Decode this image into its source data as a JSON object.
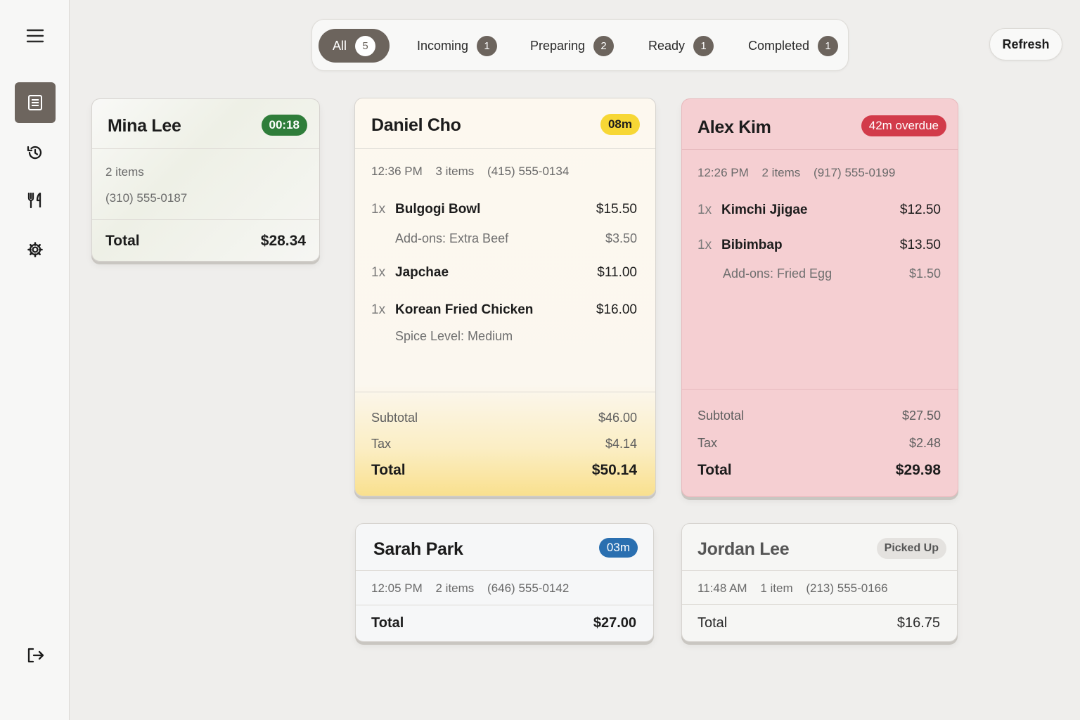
{
  "sidebar": {
    "items": [
      {
        "icon": "menu-icon"
      },
      {
        "icon": "orders-icon",
        "active": true
      },
      {
        "icon": "history-icon"
      },
      {
        "icon": "utensils-icon"
      },
      {
        "icon": "gear-icon"
      },
      {
        "icon": "logout-icon"
      }
    ]
  },
  "tabs": [
    {
      "label": "All",
      "count": "5",
      "active": true
    },
    {
      "label": "Incoming",
      "count": "1"
    },
    {
      "label": "Preparing",
      "count": "2"
    },
    {
      "label": "Ready",
      "count": "1"
    },
    {
      "label": "Completed",
      "count": "1"
    }
  ],
  "refresh_label": "Refresh",
  "colors": {
    "accent": "#6c645d",
    "badge_green": "#2f7d3a",
    "badge_yellow": "#f7d735",
    "badge_red": "#d23b4a",
    "badge_blue": "#2a6fb0",
    "badge_gray": "#e4e2df",
    "overdue_bg": "#f5cfd2",
    "preparing_bg": "#fbf3e2"
  },
  "orders": {
    "mina": {
      "customer": "Mina Lee",
      "badge": "00:18",
      "items_count": "2 items",
      "phone": "(310) 555-0187",
      "total_label": "Total",
      "total": "$28.34"
    },
    "daniel": {
      "customer": "Daniel Cho",
      "badge": "08m",
      "time": "12:36 PM",
      "items_count": "3 items",
      "phone": "(415) 555-0134",
      "lines": [
        {
          "qty": "1x",
          "name": "Bulgogi Bowl",
          "price": "$15.50",
          "sub": "Add-ons: Extra Beef",
          "sub_price": "$3.50"
        },
        {
          "qty": "1x",
          "name": "Japchae",
          "price": "$11.00"
        },
        {
          "qty": "1x",
          "name": "Korean Fried Chicken",
          "price": "$16.00",
          "sub": "Spice Level: Medium"
        }
      ],
      "subtotal_label": "Subtotal",
      "subtotal": "$46.00",
      "tax_label": "Tax",
      "tax": "$4.14",
      "total_label": "Total",
      "total": "$50.14"
    },
    "alex": {
      "customer": "Alex Kim",
      "badge": "42m overdue",
      "time": "12:26 PM",
      "items_count": "2 items",
      "phone": "(917) 555-0199",
      "lines": [
        {
          "qty": "1x",
          "name": "Kimchi Jjigae",
          "price": "$12.50"
        },
        {
          "qty": "1x",
          "name": "Bibimbap",
          "price": "$13.50",
          "sub": "Add-ons: Fried Egg",
          "sub_price": "$1.50"
        }
      ],
      "subtotal_label": "Subtotal",
      "subtotal": "$27.50",
      "tax_label": "Tax",
      "tax": "$2.48",
      "total_label": "Total",
      "total": "$29.98"
    },
    "sarah": {
      "customer": "Sarah Park",
      "badge": "03m",
      "time": "12:05 PM",
      "items_count": "2 items",
      "phone": "(646) 555-0142",
      "total_label": "Total",
      "total": "$27.00"
    },
    "jordan": {
      "customer": "Jordan Lee",
      "badge": "Picked Up",
      "time": "11:48 AM",
      "items_count": "1 item",
      "phone": "(213) 555-0166",
      "total_label": "Total",
      "total": "$16.75"
    }
  }
}
